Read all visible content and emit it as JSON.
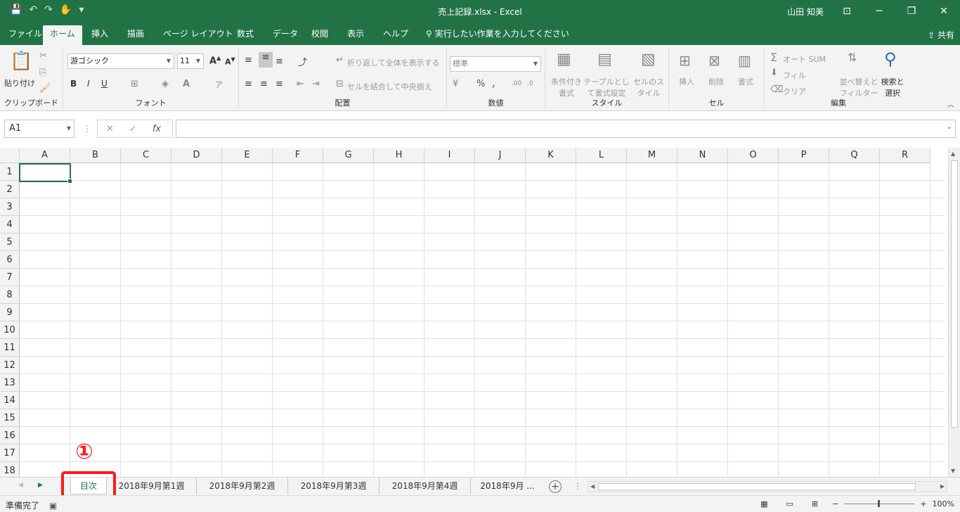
{
  "window": {
    "title": "売上記録.xlsx  -  Excel",
    "user": "山田 知美",
    "controls": [
      "⊡",
      "─",
      "❐",
      "✕"
    ]
  },
  "menu": {
    "tabs": [
      "ファイル",
      "ホーム",
      "挿入",
      "描画",
      "ページ レイアウト",
      "数式",
      "データ",
      "校閲",
      "表示",
      "ヘルプ"
    ],
    "tell_me": "実行したい作業を入力してください",
    "share": "共有"
  },
  "ribbon": {
    "clipboard": {
      "paste": "貼り付け",
      "label": "クリップボード"
    },
    "font": {
      "name": "游ゴシック",
      "size": "11",
      "label": "フォント",
      "bold": "B",
      "italic": "I",
      "underline": "U"
    },
    "alignment": {
      "wrap": "折り返して全体を表示する",
      "merge": "セルを結合して中央揃え",
      "label": "配置"
    },
    "number": {
      "format": "標準",
      "percent": "%",
      "label": "数値"
    },
    "styles": {
      "conditional": "条件付き書式",
      "table": "テーブルとして書式設定",
      "cell": "セルのスタイル",
      "label": "スタイル"
    },
    "cells": {
      "insert": "挿入",
      "delete": "削除",
      "format": "書式",
      "label": "セル"
    },
    "editing": {
      "autosum": "オート SUM",
      "fill": "フィル",
      "clear": "クリア",
      "sort": "並べ替えとフィルター",
      "find": "検索と選択",
      "label": "編集"
    }
  },
  "formula_bar": {
    "name_box": "A1",
    "fx": "fx",
    "content": ""
  },
  "grid": {
    "columns": [
      "A",
      "B",
      "C",
      "D",
      "E",
      "F",
      "G",
      "H",
      "I",
      "J",
      "K",
      "L",
      "M",
      "N",
      "O",
      "P",
      "Q",
      "R"
    ],
    "rows": [
      "1",
      "2",
      "3",
      "4",
      "5",
      "6",
      "7",
      "8",
      "9",
      "10",
      "11",
      "12",
      "13",
      "14",
      "15",
      "16",
      "17",
      "18"
    ],
    "selected_cell": "A1"
  },
  "sheets": {
    "tabs": [
      "目次",
      "2018年9月第1週",
      "2018年9月第2週",
      "2018年9月第3週",
      "2018年9月第4週",
      "2018年9月 ..."
    ],
    "active": "目次",
    "annotation": "①"
  },
  "status": {
    "text": "準備完了",
    "zoom": "100%"
  },
  "colors": {
    "excel_green": "#217346",
    "highlight_red": "#ff1a1a"
  }
}
